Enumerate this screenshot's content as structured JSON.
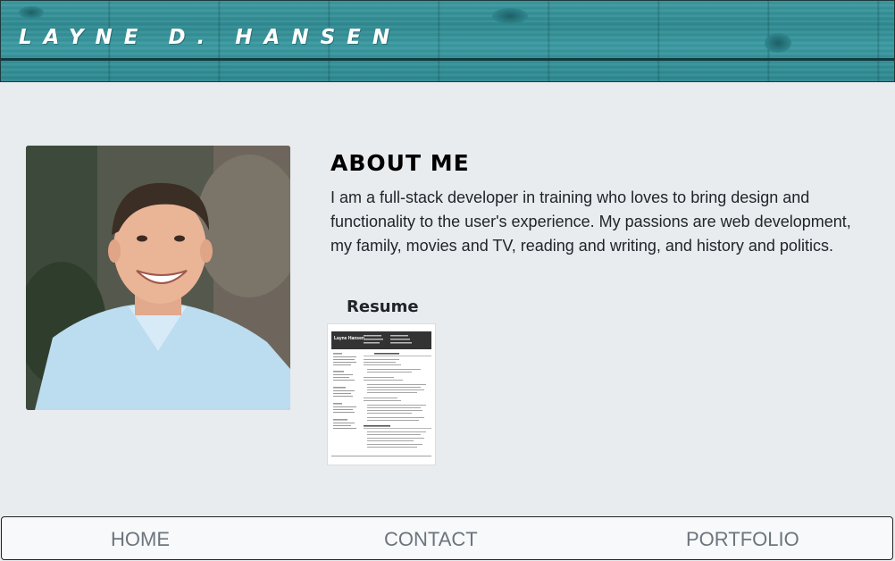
{
  "header": {
    "title": "LAYNE D. HANSEN"
  },
  "about": {
    "heading": "ABOUT ME",
    "body": "I am a full-stack developer in training who loves to bring design and functionality to the user's experience. My passions are web development, my family, movies and TV, reading and writing, and history and politics."
  },
  "resume": {
    "label": "Resume",
    "thumb_name": "Layne Hansen"
  },
  "nav": {
    "home": "HOME",
    "contact": "CONTACT",
    "portfolio": "PORTFOLIO"
  },
  "colors": {
    "header_teal": "#2f8a91",
    "page_bg": "#e9ecef",
    "nav_text": "#6c757d"
  }
}
